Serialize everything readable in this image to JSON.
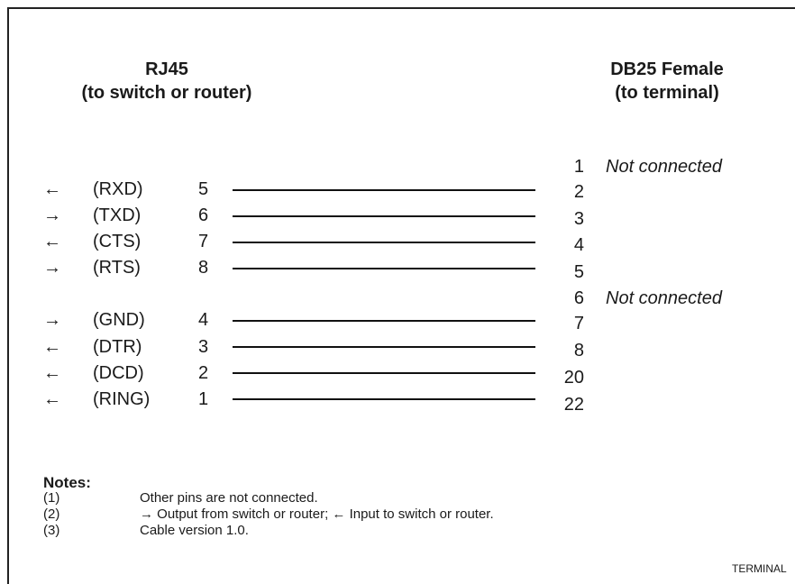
{
  "header": {
    "left_title": "RJ45",
    "left_subtitle": "(to switch or router)",
    "right_title": "DB25 Female",
    "right_subtitle": "(to terminal)"
  },
  "db25_pins": [
    {
      "pin": "1",
      "note": "Not connected"
    },
    {
      "pin": "2",
      "note": ""
    },
    {
      "pin": "3",
      "note": ""
    },
    {
      "pin": "4",
      "note": ""
    },
    {
      "pin": "5",
      "note": ""
    },
    {
      "pin": "6",
      "note": "Not connected"
    },
    {
      "pin": "7",
      "note": ""
    },
    {
      "pin": "8",
      "note": ""
    },
    {
      "pin": "20",
      "note": ""
    },
    {
      "pin": "22",
      "note": ""
    }
  ],
  "connections": [
    {
      "arrow": "←",
      "signal": "(RXD)",
      "rj45_pin": "5",
      "db25_pin": "2"
    },
    {
      "arrow": "→",
      "signal": "(TXD)",
      "rj45_pin": "6",
      "db25_pin": "3"
    },
    {
      "arrow": "←",
      "signal": "(CTS)",
      "rj45_pin": "7",
      "db25_pin": "4"
    },
    {
      "arrow": "→",
      "signal": "(RTS)",
      "rj45_pin": "8",
      "db25_pin": "5"
    },
    {
      "arrow": "→",
      "signal": "(GND)",
      "rj45_pin": "4",
      "db25_pin": "7"
    },
    {
      "arrow": "←",
      "signal": "(DTR)",
      "rj45_pin": "3",
      "db25_pin": "8"
    },
    {
      "arrow": "←",
      "signal": "(DCD)",
      "rj45_pin": "2",
      "db25_pin": "20"
    },
    {
      "arrow": "←",
      "signal": "(RING)",
      "rj45_pin": "1",
      "db25_pin": "22"
    }
  ],
  "notes": {
    "title": "Notes:",
    "items": [
      {
        "num": "(1)",
        "text": "Other pins are not connected."
      },
      {
        "num": "(2)",
        "text": "→ Output from switch or router; ← Input to switch or router."
      },
      {
        "num": "(3)",
        "text": "Cable version 1.0."
      }
    ]
  },
  "footer": "TERMINAL"
}
